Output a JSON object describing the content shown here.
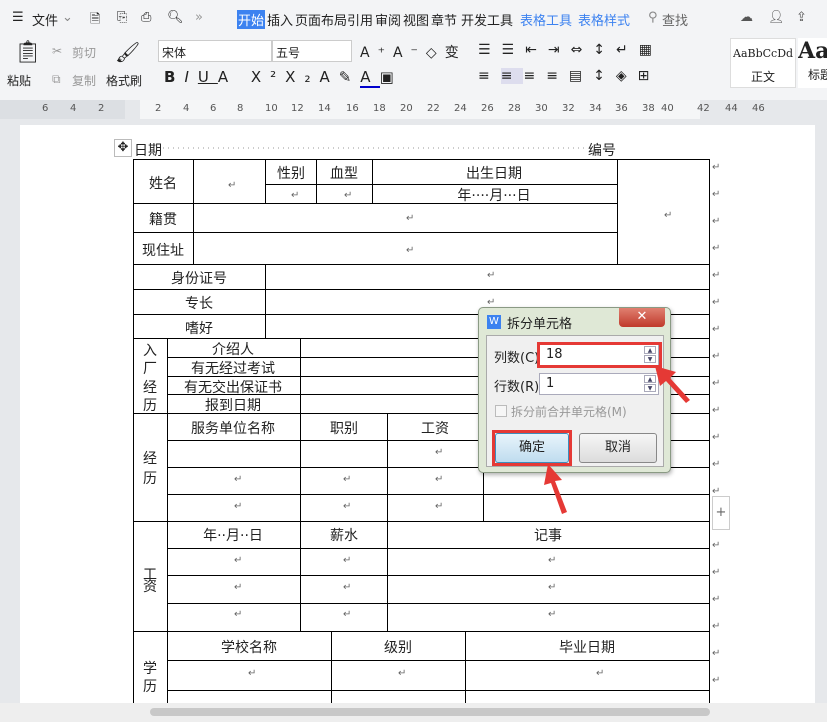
{
  "menu": {
    "file": "文件",
    "tabs": [
      "开始",
      "插入",
      "页面布局",
      "引用",
      "审阅",
      "视图",
      "章节",
      "开发工具",
      "表格工具",
      "表格样式"
    ],
    "search": "查找"
  },
  "ribbon": {
    "paste": "粘贴",
    "cut": "剪切",
    "copy": "复制",
    "format_painter": "格式刷",
    "font": "宋体",
    "size": "五号",
    "style1_preview": "AaBbCcDd",
    "style1": "正文",
    "style2_preview": "Aa",
    "style2": "标题"
  },
  "ruler": [
    "6",
    "4",
    "2",
    "2",
    "4",
    "6",
    "8",
    "10",
    "12",
    "14",
    "16",
    "18",
    "20",
    "22",
    "24",
    "26",
    "28",
    "30",
    "32",
    "34",
    "36",
    "38",
    "40",
    "42",
    "44",
    "46"
  ],
  "doc": {
    "date": "日期",
    "number": "编号",
    "name": "姓名",
    "gender": "性别",
    "blood": "血型",
    "birth": "出生日期",
    "birth_fmt": "年····月···日",
    "native": "籍贯",
    "address": "现住址",
    "id": "身份证号",
    "specialty": "专长",
    "hobby": "嗜好",
    "entry": [
      "入",
      "厂",
      "经",
      "历"
    ],
    "entry_rows": [
      "介绍人",
      "有无经过考试",
      "有无交出保证书",
      "报到日期"
    ],
    "exp": [
      "经",
      "历"
    ],
    "exp_head": [
      "服务单位名称",
      "职别",
      "工资"
    ],
    "wage": [
      "工",
      "资"
    ],
    "wage_head": [
      "年··月··日",
      "薪水",
      "记事"
    ],
    "edu": [
      "学",
      "历"
    ],
    "edu_head": [
      "学校名称",
      "级别",
      "毕业日期"
    ],
    "pm": "↵"
  },
  "dialog": {
    "title": "拆分单元格",
    "cols_label": "列数(C)",
    "cols_value": "18",
    "rows_label": "行数(R):",
    "rows_value": "1",
    "merge_label": "拆分前合并单元格(M)",
    "ok": "确定",
    "cancel": "取消"
  },
  "colors": {
    "accent": "#3c82f0",
    "highlight": "#e53935"
  }
}
